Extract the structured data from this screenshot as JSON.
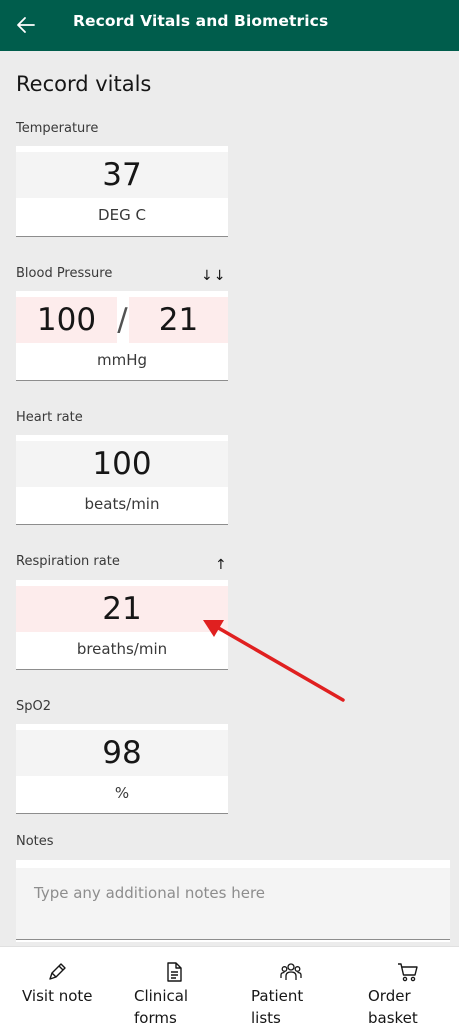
{
  "header": {
    "title": "Record Vitals and Biometrics",
    "back_icon": "arrow-left-icon"
  },
  "section_title": "Record vitals",
  "temperature": {
    "label": "Temperature",
    "value": "37",
    "unit": "DEG C"
  },
  "blood_pressure": {
    "label": "Blood Pressure",
    "flags": "↓↓",
    "systolic": "100",
    "separator": "/",
    "diastolic": "21",
    "unit": "mmHg"
  },
  "heart_rate": {
    "label": "Heart rate",
    "value": "100",
    "unit": "beats/min"
  },
  "respiration_rate": {
    "label": "Respiration rate",
    "flags": "↑",
    "value": "21",
    "unit": "breaths/min"
  },
  "spo2": {
    "label": "SpO2",
    "value": "98",
    "unit": "%"
  },
  "notes": {
    "label": "Notes",
    "placeholder": "Type any additional notes here"
  },
  "bottom_nav": {
    "visit_note": "Visit note",
    "clinical_forms_1": "Clinical",
    "clinical_forms_2": "forms",
    "patient_lists_1": "Patient",
    "patient_lists_2": "lists",
    "order_basket_1": "Order",
    "order_basket_2": "basket"
  },
  "colors": {
    "header_bg": "#005d4c",
    "abnormal_bg": "#fdecec",
    "annotation_arrow": "#e02020"
  }
}
